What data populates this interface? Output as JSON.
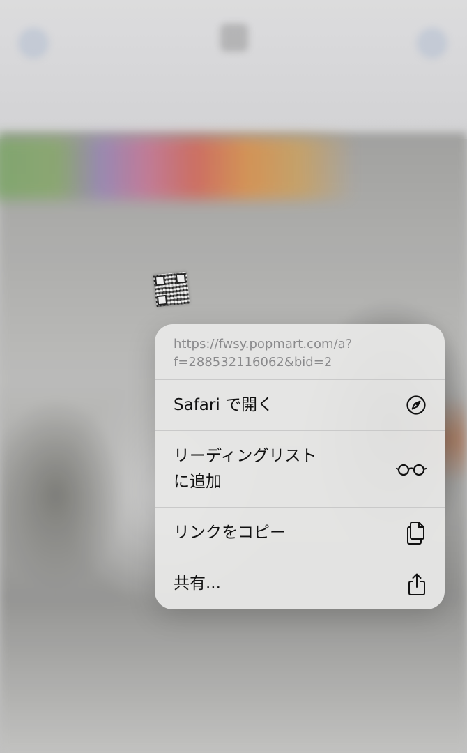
{
  "menu": {
    "url_lines": [
      "https://fwsy.popmart.com/a?",
      "f=288532116062&bid=2"
    ],
    "items": [
      {
        "label_lines": [
          "Safari で開く"
        ],
        "icon": "compass-icon"
      },
      {
        "label_lines": [
          "リーディングリスト",
          "に追加"
        ],
        "icon": "glasses-icon"
      },
      {
        "label_lines": [
          "リンクをコピー"
        ],
        "icon": "copy-icon"
      },
      {
        "label_lines": [
          "共有..."
        ],
        "icon": "share-icon"
      }
    ]
  },
  "colors": {
    "menu_bg": "#e8e8e7",
    "separator": "#c9c9c9",
    "url_text": "#8a8a8c",
    "label_text": "#111111"
  }
}
